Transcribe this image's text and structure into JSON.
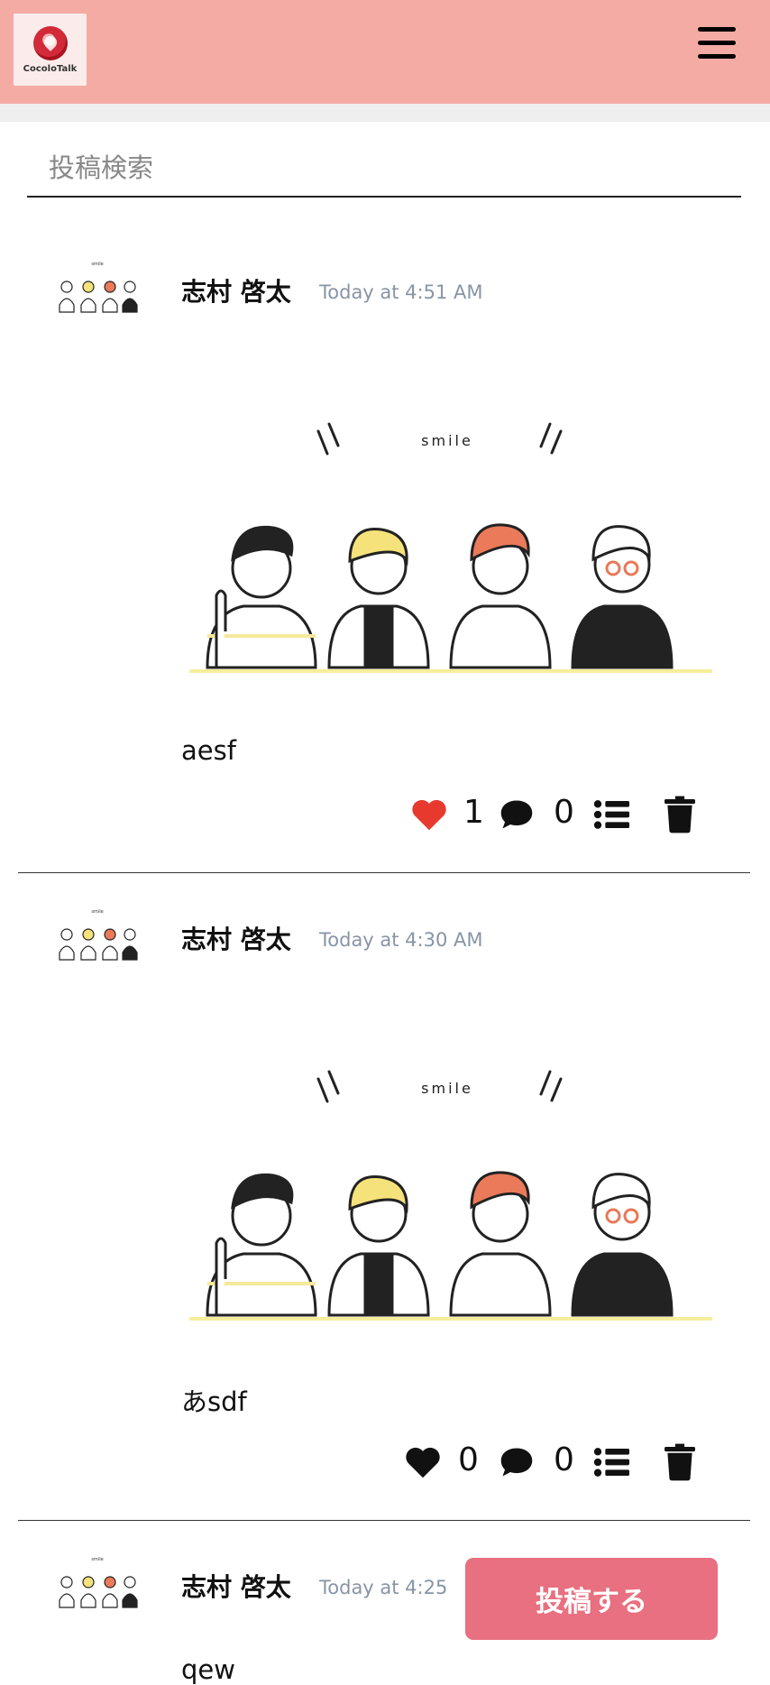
{
  "app": {
    "logo_text": "CocoloTalk"
  },
  "header": {
    "bg_color": "#f4aba4",
    "menu_icon": "hamburger-icon"
  },
  "search": {
    "placeholder": "投稿検索",
    "value": ""
  },
  "posts": [
    {
      "author": "志村 啓太",
      "time": "Today at 4:51 AM",
      "image_caption": "smile",
      "text": "aesf",
      "likes": "1",
      "comments": "0",
      "liked": true
    },
    {
      "author": "志村 啓太",
      "time": "Today at 4:30 AM",
      "image_caption": "smile",
      "text": "あsdf",
      "likes": "0",
      "comments": "0",
      "liked": false
    },
    {
      "author": "志村 啓太",
      "time": "Today at 4:25",
      "text": "qew"
    }
  ],
  "icons": {
    "like": "heart-icon",
    "comment": "comment-icon",
    "list": "list-icon",
    "delete": "trash-icon"
  },
  "colors": {
    "like_active": "#e8392f",
    "accent": "#e87080"
  },
  "compose": {
    "button_label": "投稿する"
  }
}
